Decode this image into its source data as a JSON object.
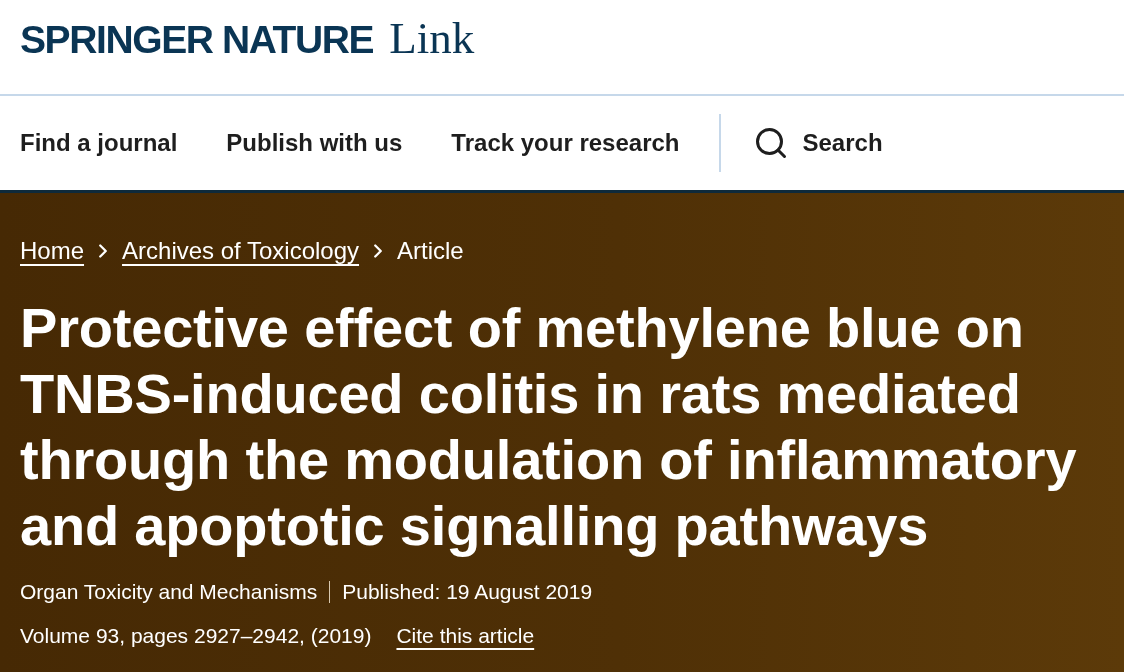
{
  "logo": {
    "brand": "SPRINGER NATURE",
    "product": "Link"
  },
  "nav": {
    "items": [
      {
        "label": "Find a journal"
      },
      {
        "label": "Publish with us"
      },
      {
        "label": "Track your research"
      }
    ],
    "search": {
      "label": "Search"
    }
  },
  "breadcrumb": [
    {
      "label": "Home",
      "kind": "link"
    },
    {
      "label": "Archives of Toxicology",
      "kind": "link"
    },
    {
      "label": "Article",
      "kind": "current"
    }
  ],
  "article": {
    "title": "Protective effect of methylene blue on TNBS-induced colitis in rats mediated through the modulation of inflammatory and apoptotic signalling pathways",
    "section": "Organ Toxicity and Mechanisms",
    "published": "Published: 19 August 2019",
    "citation": "Volume 93, pages 2927–2942, (2019)",
    "cite_link": "Cite this article"
  }
}
